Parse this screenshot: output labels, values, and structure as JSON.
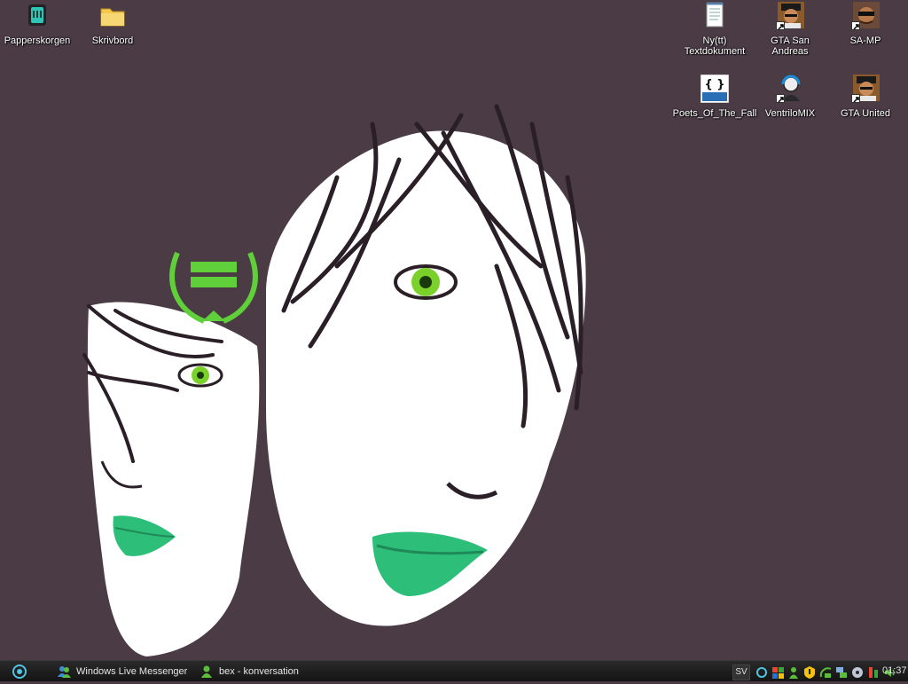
{
  "desktop": {
    "background_color": "#4a3b45",
    "icons": [
      {
        "label": "Papperskorgen",
        "icon": "recycle-bin-icon"
      },
      {
        "label": "Skrivbord",
        "icon": "folder-icon"
      },
      {
        "label": "Ny(tt)\nTextdokument",
        "icon": "text-document-icon"
      },
      {
        "label": "GTA San Andreas",
        "icon": "gta-san-andreas-icon"
      },
      {
        "label": "SA-MP",
        "icon": "sa-mp-icon"
      },
      {
        "label": "Poets_Of_The_Fall",
        "icon": "matroska-file-icon"
      },
      {
        "label": "VentriloMIX",
        "icon": "ventrilo-icon"
      },
      {
        "label": "GTA United",
        "icon": "gta-united-icon"
      }
    ]
  },
  "taskbar": {
    "tasks": [
      {
        "label": "Windows Live Messenger",
        "icon": "messenger-icon"
      },
      {
        "label": "bex - konversation",
        "icon": "conversation-icon"
      }
    ],
    "language": "SV",
    "clock": "01:37",
    "accent_green": "#3ad36f"
  }
}
